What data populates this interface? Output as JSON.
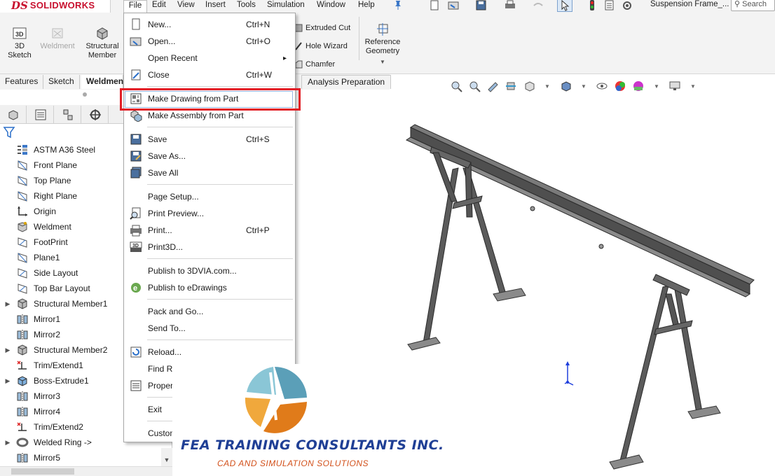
{
  "app": {
    "logo_ds": "DS",
    "logo_text": "SOLIDWORKS",
    "doc_title": "Suspension Frame_...",
    "search_placeholder": "Search"
  },
  "menubar": [
    "File",
    "Edit",
    "View",
    "Insert",
    "Tools",
    "Simulation",
    "Window",
    "Help"
  ],
  "commands": {
    "sketch3d": "3D\nSketch",
    "weldment": "Weldment",
    "structural_member": "Structural\nMember",
    "extruded_cut": "Extruded Cut",
    "hole_wizard": "Hole Wizard",
    "chamfer": "Chamfer",
    "reference_geometry": "Reference\nGeometry"
  },
  "tabs": [
    "Features",
    "Sketch",
    "Weldmen",
    "Analysis Preparation"
  ],
  "feature_tree": [
    {
      "label": "ASTM A36 Steel",
      "icon": "material-icon",
      "expand": false
    },
    {
      "label": "Front Plane",
      "icon": "plane-icon",
      "expand": false
    },
    {
      "label": "Top Plane",
      "icon": "plane-icon",
      "expand": false
    },
    {
      "label": "Right Plane",
      "icon": "plane-icon",
      "expand": false
    },
    {
      "label": "Origin",
      "icon": "origin-icon",
      "expand": false
    },
    {
      "label": "Weldment",
      "icon": "weldment-icon",
      "expand": false
    },
    {
      "label": "FootPrint",
      "icon": "sketch-icon",
      "expand": false
    },
    {
      "label": "Plane1",
      "icon": "plane-icon",
      "expand": false
    },
    {
      "label": "Side Layout",
      "icon": "sketch-icon",
      "expand": false
    },
    {
      "label": "Top Bar Layout",
      "icon": "sketch-icon",
      "expand": false
    },
    {
      "label": "Structural Member1",
      "icon": "structural-member-icon",
      "expand": true
    },
    {
      "label": "Mirror1",
      "icon": "mirror-icon",
      "expand": false
    },
    {
      "label": "Mirror2",
      "icon": "mirror-icon",
      "expand": false
    },
    {
      "label": "Structural Member2",
      "icon": "structural-member-icon",
      "expand": true
    },
    {
      "label": "Trim/Extend1",
      "icon": "trim-icon",
      "expand": false
    },
    {
      "label": "Boss-Extrude1",
      "icon": "extrude-icon",
      "expand": true
    },
    {
      "label": "Mirror3",
      "icon": "mirror-icon",
      "expand": false
    },
    {
      "label": "Mirror4",
      "icon": "mirror-icon",
      "expand": false
    },
    {
      "label": "Trim/Extend2",
      "icon": "trim-icon",
      "expand": false
    },
    {
      "label": "Welded Ring ->",
      "icon": "ring-icon",
      "expand": true
    },
    {
      "label": "Mirror5",
      "icon": "mirror-icon",
      "expand": false
    }
  ],
  "file_menu": [
    {
      "label": "New...",
      "shortcut": "Ctrl+N",
      "icon": "new-icon"
    },
    {
      "label": "Open...",
      "shortcut": "Ctrl+O",
      "icon": "open-icon"
    },
    {
      "label": "Open Recent",
      "shortcut": "",
      "icon": "",
      "submenu": true
    },
    {
      "label": "Close",
      "shortcut": "Ctrl+W",
      "icon": "close-doc-icon"
    },
    {
      "label": "Make Drawing from Part",
      "shortcut": "",
      "icon": "make-drawing-icon"
    },
    {
      "label": "Make Assembly from Part",
      "shortcut": "",
      "icon": "make-assembly-icon"
    },
    {
      "label": "Save",
      "shortcut": "Ctrl+S",
      "icon": "save-icon"
    },
    {
      "label": "Save As...",
      "shortcut": "",
      "icon": "save-as-icon"
    },
    {
      "label": "Save All",
      "shortcut": "",
      "icon": "save-all-icon"
    },
    {
      "label": "Page Setup...",
      "shortcut": "",
      "icon": ""
    },
    {
      "label": "Print Preview...",
      "shortcut": "",
      "icon": "print-preview-icon"
    },
    {
      "label": "Print...",
      "shortcut": "Ctrl+P",
      "icon": "print-icon"
    },
    {
      "label": "Print3D...",
      "shortcut": "",
      "icon": "print3d-icon"
    },
    {
      "label": "Publish to 3DVIA.com...",
      "shortcut": "",
      "icon": ""
    },
    {
      "label": "Publish to eDrawings",
      "shortcut": "",
      "icon": "edrawings-icon"
    },
    {
      "label": "Pack and Go...",
      "shortcut": "",
      "icon": ""
    },
    {
      "label": "Send To...",
      "shortcut": "",
      "icon": ""
    },
    {
      "label": "Reload...",
      "shortcut": "",
      "icon": "reload-icon"
    },
    {
      "label": "Find Re",
      "shortcut": "",
      "icon": ""
    },
    {
      "label": "Propert",
      "shortcut": "",
      "icon": "properties-icon"
    },
    {
      "label": "Exit",
      "shortcut": "",
      "icon": ""
    },
    {
      "label": "Custom",
      "shortcut": "",
      "icon": ""
    }
  ],
  "watermark": {
    "name": "FEA TRAINING CONSULTANTS INC.",
    "tagline": "CAD AND SIMULATION SOLUTIONS"
  }
}
